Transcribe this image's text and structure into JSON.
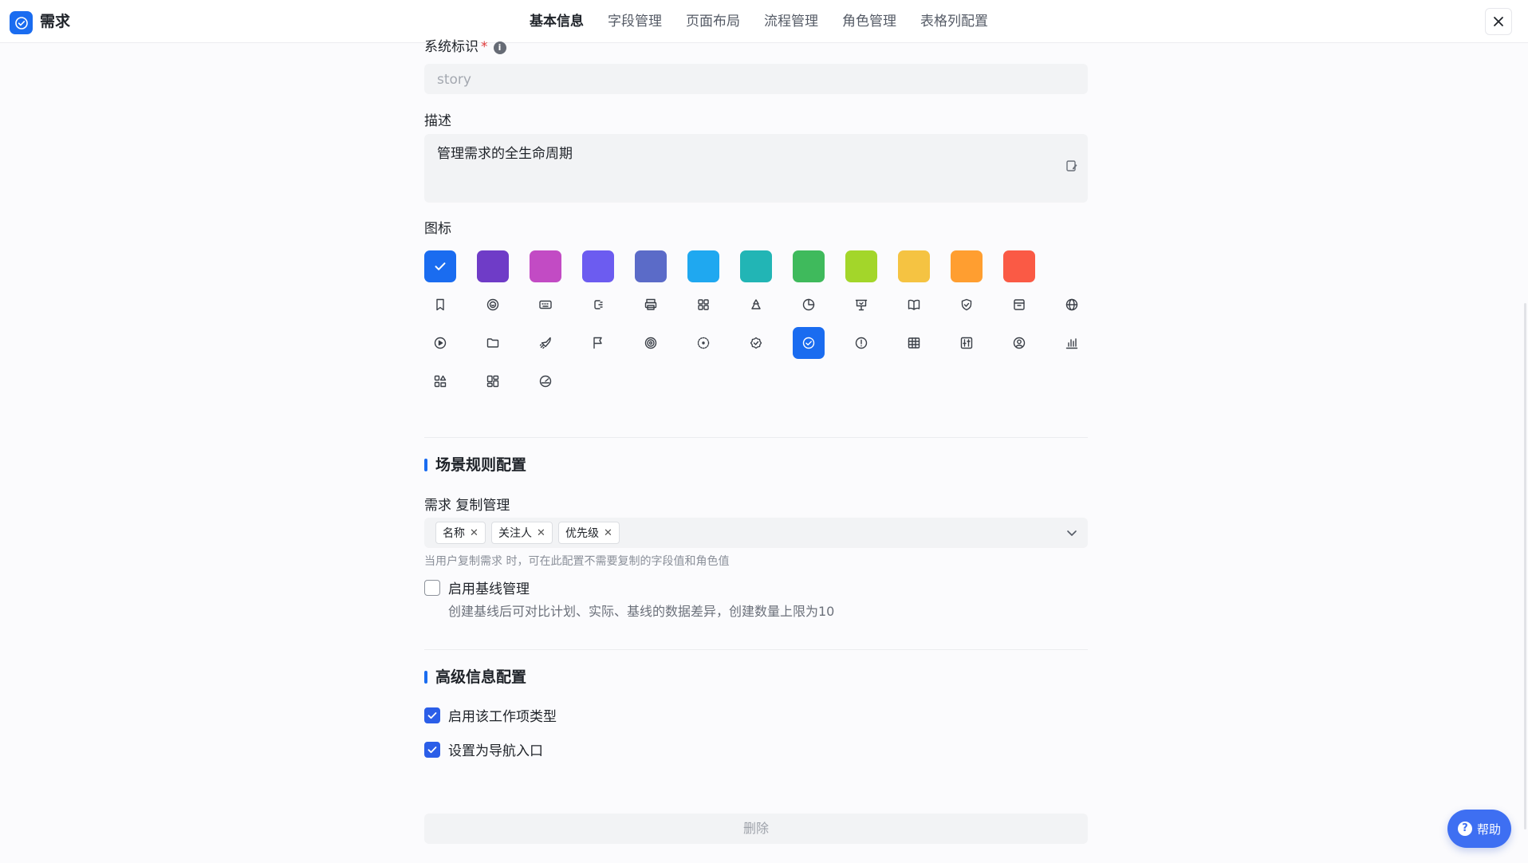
{
  "app": {
    "title": "需求",
    "logo_icon": "check-circle-icon",
    "brand_color": "#1a6cf0"
  },
  "tabs": [
    {
      "label": "基本信息",
      "active": true
    },
    {
      "label": "字段管理",
      "active": false
    },
    {
      "label": "页面布局",
      "active": false
    },
    {
      "label": "流程管理",
      "active": false
    },
    {
      "label": "角色管理",
      "active": false
    },
    {
      "label": "表格列配置",
      "active": false
    }
  ],
  "form": {
    "system_id_label": "系统标识",
    "system_id_required": "*",
    "system_id_info": "i",
    "system_id_value": "story",
    "description_label": "描述",
    "description_value": "管理需求的全生命周期",
    "icon_label": "图标"
  },
  "icon_colors": [
    "#1a6cf0",
    "#6f3cc7",
    "#c24bc4",
    "#6c5cf0",
    "#5b6bc8",
    "#1fa8f0",
    "#22b5b5",
    "#3fba5c",
    "#a3d62a",
    "#f5c342",
    "#ff9e30",
    "#fa5a45"
  ],
  "icon_glyphs": [
    "bookmark-icon",
    "smile-icon",
    "keyboard-icon",
    "indent-icon",
    "printer-icon",
    "grid-icon",
    "recycle-icon",
    "pie-chart-icon",
    "presentation-icon",
    "book-icon",
    "shield-icon",
    "archive-icon",
    "globe-icon",
    "play-circle-icon",
    "folder-icon",
    "rocket-icon",
    "flag-icon",
    "target-icon",
    "dots-circle-icon",
    "badge-check-icon",
    "check-circle-icon",
    "alert-circle-icon",
    "table-icon",
    "sliders-icon",
    "user-circle-icon",
    "bar-chart-icon",
    "shapes-icon",
    "layout-icon",
    "dashboard-icon"
  ],
  "selected_glyph": "check-circle-icon",
  "scene": {
    "title": "场景规则配置",
    "copy_label": "需求 复制管理",
    "tags": [
      "名称",
      "关注人",
      "优先级"
    ],
    "copy_hint": "当用户复制需求 时，可在此配置不需要复制的字段值和角色值",
    "baseline_label": "启用基线管理",
    "baseline_checked": false,
    "baseline_desc": "创建基线后可对比计划、实际、基线的数据差异，创建数量上限为10"
  },
  "advanced": {
    "title": "高级信息配置",
    "enable_label": "启用该工作项类型",
    "enable_checked": true,
    "nav_label": "设置为导航入口",
    "nav_checked": true
  },
  "delete_label": "删除",
  "help_label": "帮助"
}
